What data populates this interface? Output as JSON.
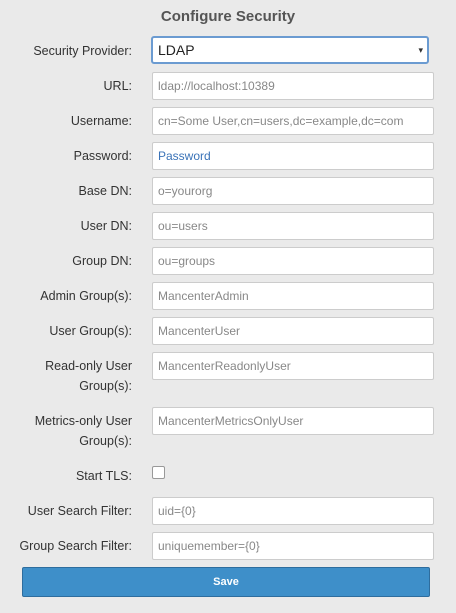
{
  "title": "Configure Security",
  "security_provider": {
    "label": "Security Provider:",
    "value": "LDAP",
    "caret": "▾"
  },
  "fields": {
    "url": {
      "label": "URL:",
      "value": "ldap://localhost:10389"
    },
    "username": {
      "label": "Username:",
      "value": "cn=Some User,cn=users,dc=example,dc=com"
    },
    "password": {
      "label": "Password:",
      "value": "Password"
    },
    "base_dn": {
      "label": "Base DN:",
      "value": "o=yourorg"
    },
    "user_dn": {
      "label": "User DN:",
      "value": "ou=users"
    },
    "group_dn": {
      "label": "Group DN:",
      "value": "ou=groups"
    },
    "admin_groups": {
      "label": "Admin Group(s):",
      "value": "MancenterAdmin"
    },
    "user_groups": {
      "label": "User Group(s):",
      "value": "MancenterUser"
    },
    "readonly_groups": {
      "label_line1": "Read-only User",
      "label_line2": "Group(s):",
      "value": "MancenterReadonlyUser"
    },
    "metrics_groups": {
      "label_line1": "Metrics-only User",
      "label_line2": "Group(s):",
      "value": "MancenterMetricsOnlyUser"
    },
    "start_tls": {
      "label": "Start TLS:",
      "checked": false
    },
    "user_search_filter": {
      "label": "User Search Filter:",
      "value": "uid={0}"
    },
    "group_search_filter": {
      "label": "Group Search Filter:",
      "value": "uniquemember={0}"
    }
  },
  "save_label": "Save"
}
